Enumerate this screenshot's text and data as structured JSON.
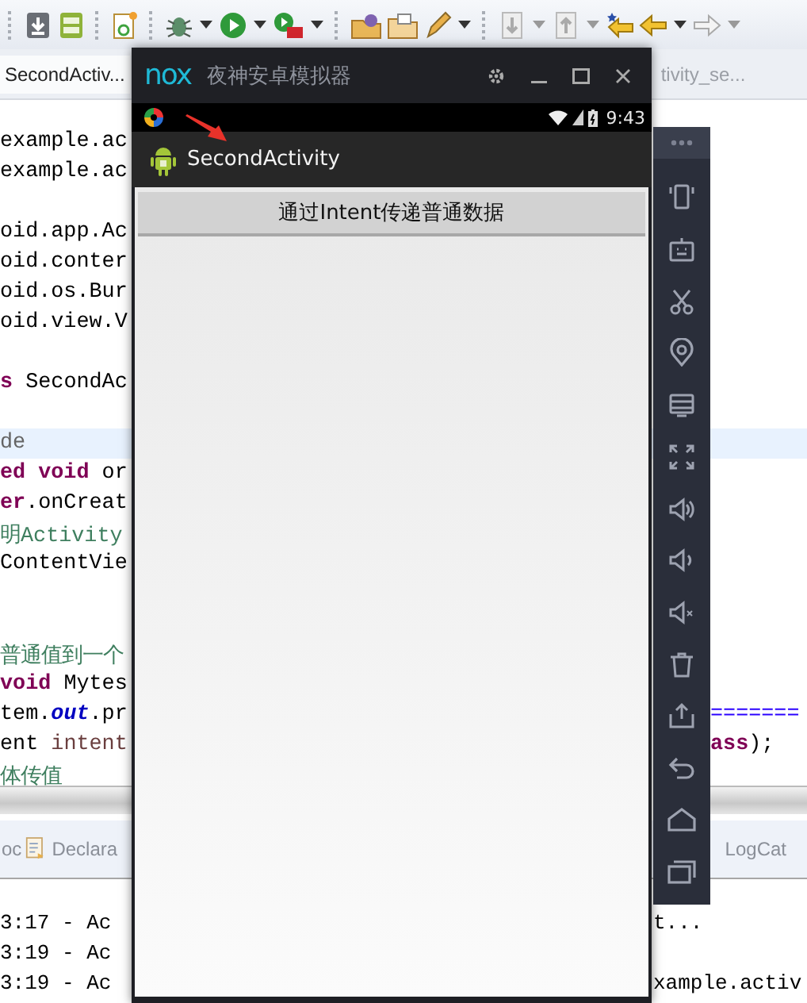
{
  "ide": {
    "editor_tabs": [
      {
        "label": "SecondActiv...",
        "selected": true
      },
      {
        "label": "tivity_se...",
        "selected": false
      }
    ],
    "code_lines": [
      {
        "kind": "code",
        "highlighted": false,
        "segments": [
          {
            "text": "example.ac",
            "kind": "plain"
          }
        ]
      },
      {
        "kind": "code",
        "highlighted": false,
        "segments": [
          {
            "text": "example.ac",
            "kind": "plain"
          }
        ]
      },
      {
        "kind": "blank",
        "highlighted": false
      },
      {
        "kind": "code",
        "highlighted": false,
        "segments": [
          {
            "text": "oid.app.Ac",
            "kind": "plain"
          }
        ]
      },
      {
        "kind": "code",
        "highlighted": false,
        "segments": [
          {
            "text": "oid.conter",
            "kind": "plain"
          }
        ]
      },
      {
        "kind": "code",
        "highlighted": false,
        "segments": [
          {
            "text": "oid.os.Bur",
            "kind": "plain"
          }
        ]
      },
      {
        "kind": "code",
        "highlighted": false,
        "segments": [
          {
            "text": "oid.view.V",
            "kind": "plain"
          }
        ]
      },
      {
        "kind": "blank",
        "highlighted": false
      },
      {
        "kind": "code",
        "highlighted": false,
        "segments": [
          {
            "text": "s",
            "kind": "keyword"
          },
          {
            "text": " SecondAc",
            "kind": "plain"
          }
        ]
      },
      {
        "kind": "blank",
        "highlighted": false
      },
      {
        "kind": "code",
        "highlighted": true,
        "segments": [
          {
            "text": "de",
            "kind": "annotation"
          }
        ]
      },
      {
        "kind": "code",
        "highlighted": false,
        "segments": [
          {
            "text": "ed void",
            "kind": "keyword"
          },
          {
            "text": " or",
            "kind": "plain"
          }
        ]
      },
      {
        "kind": "code",
        "highlighted": false,
        "segments": [
          {
            "text": "er",
            "kind": "keyword"
          },
          {
            "text": ".onCreat",
            "kind": "plain"
          }
        ]
      },
      {
        "kind": "code",
        "highlighted": false,
        "segments": [
          {
            "text": "明Activity",
            "kind": "comment"
          }
        ]
      },
      {
        "kind": "code",
        "highlighted": false,
        "segments": [
          {
            "text": "ContentVie",
            "kind": "plain"
          }
        ]
      },
      {
        "kind": "blank",
        "highlighted": false
      },
      {
        "kind": "blank",
        "highlighted": false
      },
      {
        "kind": "code",
        "highlighted": false,
        "segments": [
          {
            "text": "普通值到一个",
            "kind": "comment"
          }
        ]
      },
      {
        "kind": "code",
        "highlighted": false,
        "segments": [
          {
            "text": "void",
            "kind": "keyword"
          },
          {
            "text": " Mytes",
            "kind": "plain"
          }
        ]
      },
      {
        "kind": "code",
        "highlighted": false,
        "segments": [
          {
            "text": "tem.",
            "kind": "plain"
          },
          {
            "text": "out",
            "kind": "field"
          },
          {
            "text": ".pr",
            "kind": "plain"
          }
        ],
        "right": [
          {
            "text": "=======",
            "kind": "string"
          }
        ]
      },
      {
        "kind": "code",
        "highlighted": false,
        "segments": [
          {
            "text": "ent ",
            "kind": "plain"
          },
          {
            "text": "intent",
            "kind": "local"
          }
        ],
        "right": [
          {
            "text": "ass",
            "kind": "keyword"
          },
          {
            "text": ");",
            "kind": "plain"
          }
        ]
      },
      {
        "kind": "code",
        "highlighted": false,
        "segments": [
          {
            "text": "体传值",
            "kind": "comment"
          }
        ]
      }
    ],
    "panel_tabs": [
      {
        "label": "oc",
        "icon": false
      },
      {
        "label": "Declara",
        "icon": true
      },
      {
        "label": "LogCat",
        "icon": false
      }
    ],
    "console_lines": [
      {
        "left": "3:17 - Ac",
        "right": "t..."
      },
      {
        "left": "3:19 - Ac"
      },
      {
        "left": "3:19 - Ac",
        "right": "xample.activ"
      }
    ]
  },
  "emulator": {
    "logo": "nox",
    "title": "夜神安卓模拟器",
    "time": "9:43",
    "app_title": "SecondActivity",
    "button": "通过Intent传递普通数据"
  }
}
